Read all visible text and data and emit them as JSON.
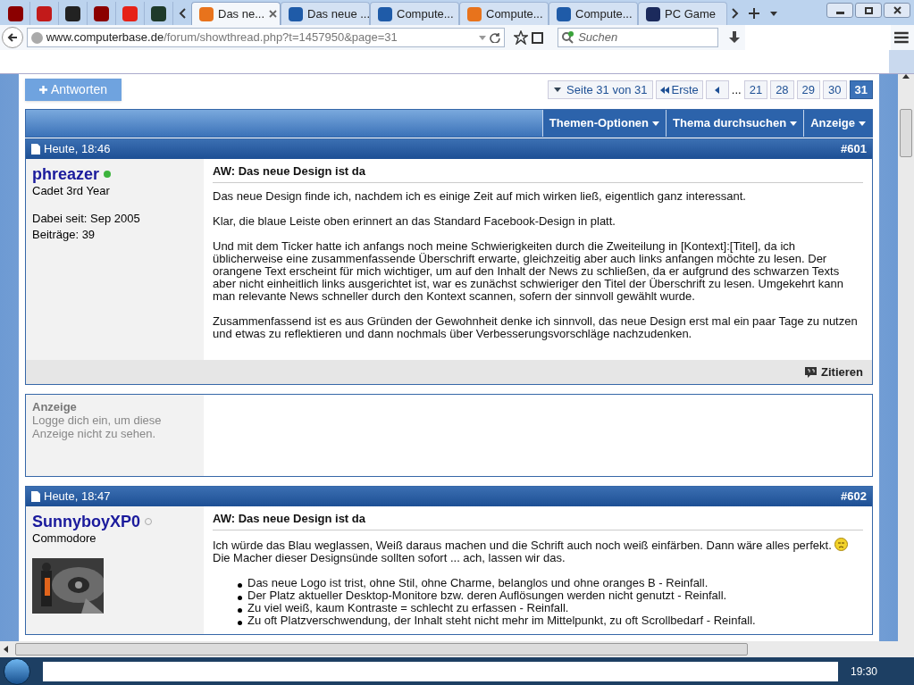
{
  "browser": {
    "tabs": [
      {
        "title": "Das ne...",
        "selected": true
      },
      {
        "title": "Das neue ...",
        "selected": false
      },
      {
        "title": "Compute...",
        "selected": false
      },
      {
        "title": "Compute...",
        "selected": false
      },
      {
        "title": "Compute...",
        "selected": false
      },
      {
        "title": "PC Game",
        "selected": false
      }
    ],
    "url_host": "www.computerbase.de",
    "url_path": "/forum/showthread.php?t=1457950&page=31",
    "search_placeholder": "Suchen"
  },
  "forum": {
    "reply_button": "Antworten",
    "page_info": "Seite 31 von 31",
    "first": "Erste",
    "ellipsis": "...",
    "pages": [
      {
        "label": "21",
        "selected": false
      },
      {
        "label": "28",
        "selected": false
      },
      {
        "label": "29",
        "selected": false
      },
      {
        "label": "30",
        "selected": false
      },
      {
        "label": "31",
        "selected": true
      }
    ],
    "menus": [
      "Themen-Optionen",
      "Thema durchsuchen",
      "Anzeige"
    ],
    "posts": [
      {
        "kind": "post",
        "date": "Heute, 18:46",
        "number": "#601",
        "user": "phreazer",
        "online": true,
        "rank": "Cadet 3rd Year",
        "info": [
          "Dabei seit: Sep 2005",
          "Beiträge: 39"
        ],
        "title": "AW: Das neue Design ist da",
        "body": [
          {
            "kind": "text",
            "text": "Das neue Design finde ich, nachdem ich es einige Zeit auf mich wirken ließ, eigentlich ganz interessant."
          },
          {
            "kind": "text",
            "text": "Klar, die blaue Leiste oben erinnert an das Standard Facebook-Design in platt."
          },
          {
            "kind": "text",
            "text": "Und mit dem Ticker hatte ich anfangs noch meine Schwierigkeiten durch die Zweiteilung in [Kontext]:[Titel], da ich üblicherweise eine zusammenfassende Überschrift erwarte, gleichzeitig aber auch links anfangen möchte zu lesen. Der orangene Text erscheint für mich wichtiger, um auf den Inhalt der News zu schließen, da er aufgrund des schwarzen Texts aber nicht einheitlich links ausgerichtet ist, war es zunächst schwieriger den Titel der Überschrift zu lesen. Umgekehrt kann man relevante News schneller durch den Kontext scannen, sofern der sinnvoll gewählt wurde."
          },
          {
            "kind": "text",
            "text": "Zusammenfassend ist es aus Gründen der Gewohnheit denke ich sinnvoll, das neue Design erst mal ein paar Tage zu nutzen und etwas zu reflektieren und dann nochmals über Verbesserungsvorschläge nachzudenken."
          }
        ],
        "quote_button": "Zitieren"
      },
      {
        "kind": "ad",
        "title": "Anzeige",
        "text": "Logge dich ein, um diese Anzeige nicht zu sehen."
      },
      {
        "kind": "post",
        "date": "Heute, 18:47",
        "number": "#602",
        "user": "SunnyboyXP0",
        "online": false,
        "rank": "Commodore",
        "avatar": true,
        "title": "AW: Das neue Design ist da",
        "body": [
          {
            "kind": "smiley_text",
            "before": "Ich würde das Blau weglassen, Weiß daraus machen und die Schrift auch noch weiß einfärben. Dann wäre alles perfekt.",
            "after": "Die Macher dieser Designsünde sollten sofort ... ach, lassen wir das."
          },
          {
            "kind": "list",
            "items": [
              "Das neue Logo ist trist, ohne Stil, ohne Charme, belanglos und ohne oranges B - Reinfall.",
              "Der Platz aktueller Desktop-Monitore bzw. deren Auflösungen werden nicht genutzt - Reinfall.",
              "Zu viel weiß, kaum Kontraste = schlecht zu erfassen - Reinfall.",
              "Zu oft Platzverschwendung, der Inhalt steht nicht mehr im Mittelpunkt, zu oft Scrollbedarf - Reinfall."
            ]
          }
        ]
      }
    ]
  },
  "taskbar": {
    "clock": "19:30"
  }
}
